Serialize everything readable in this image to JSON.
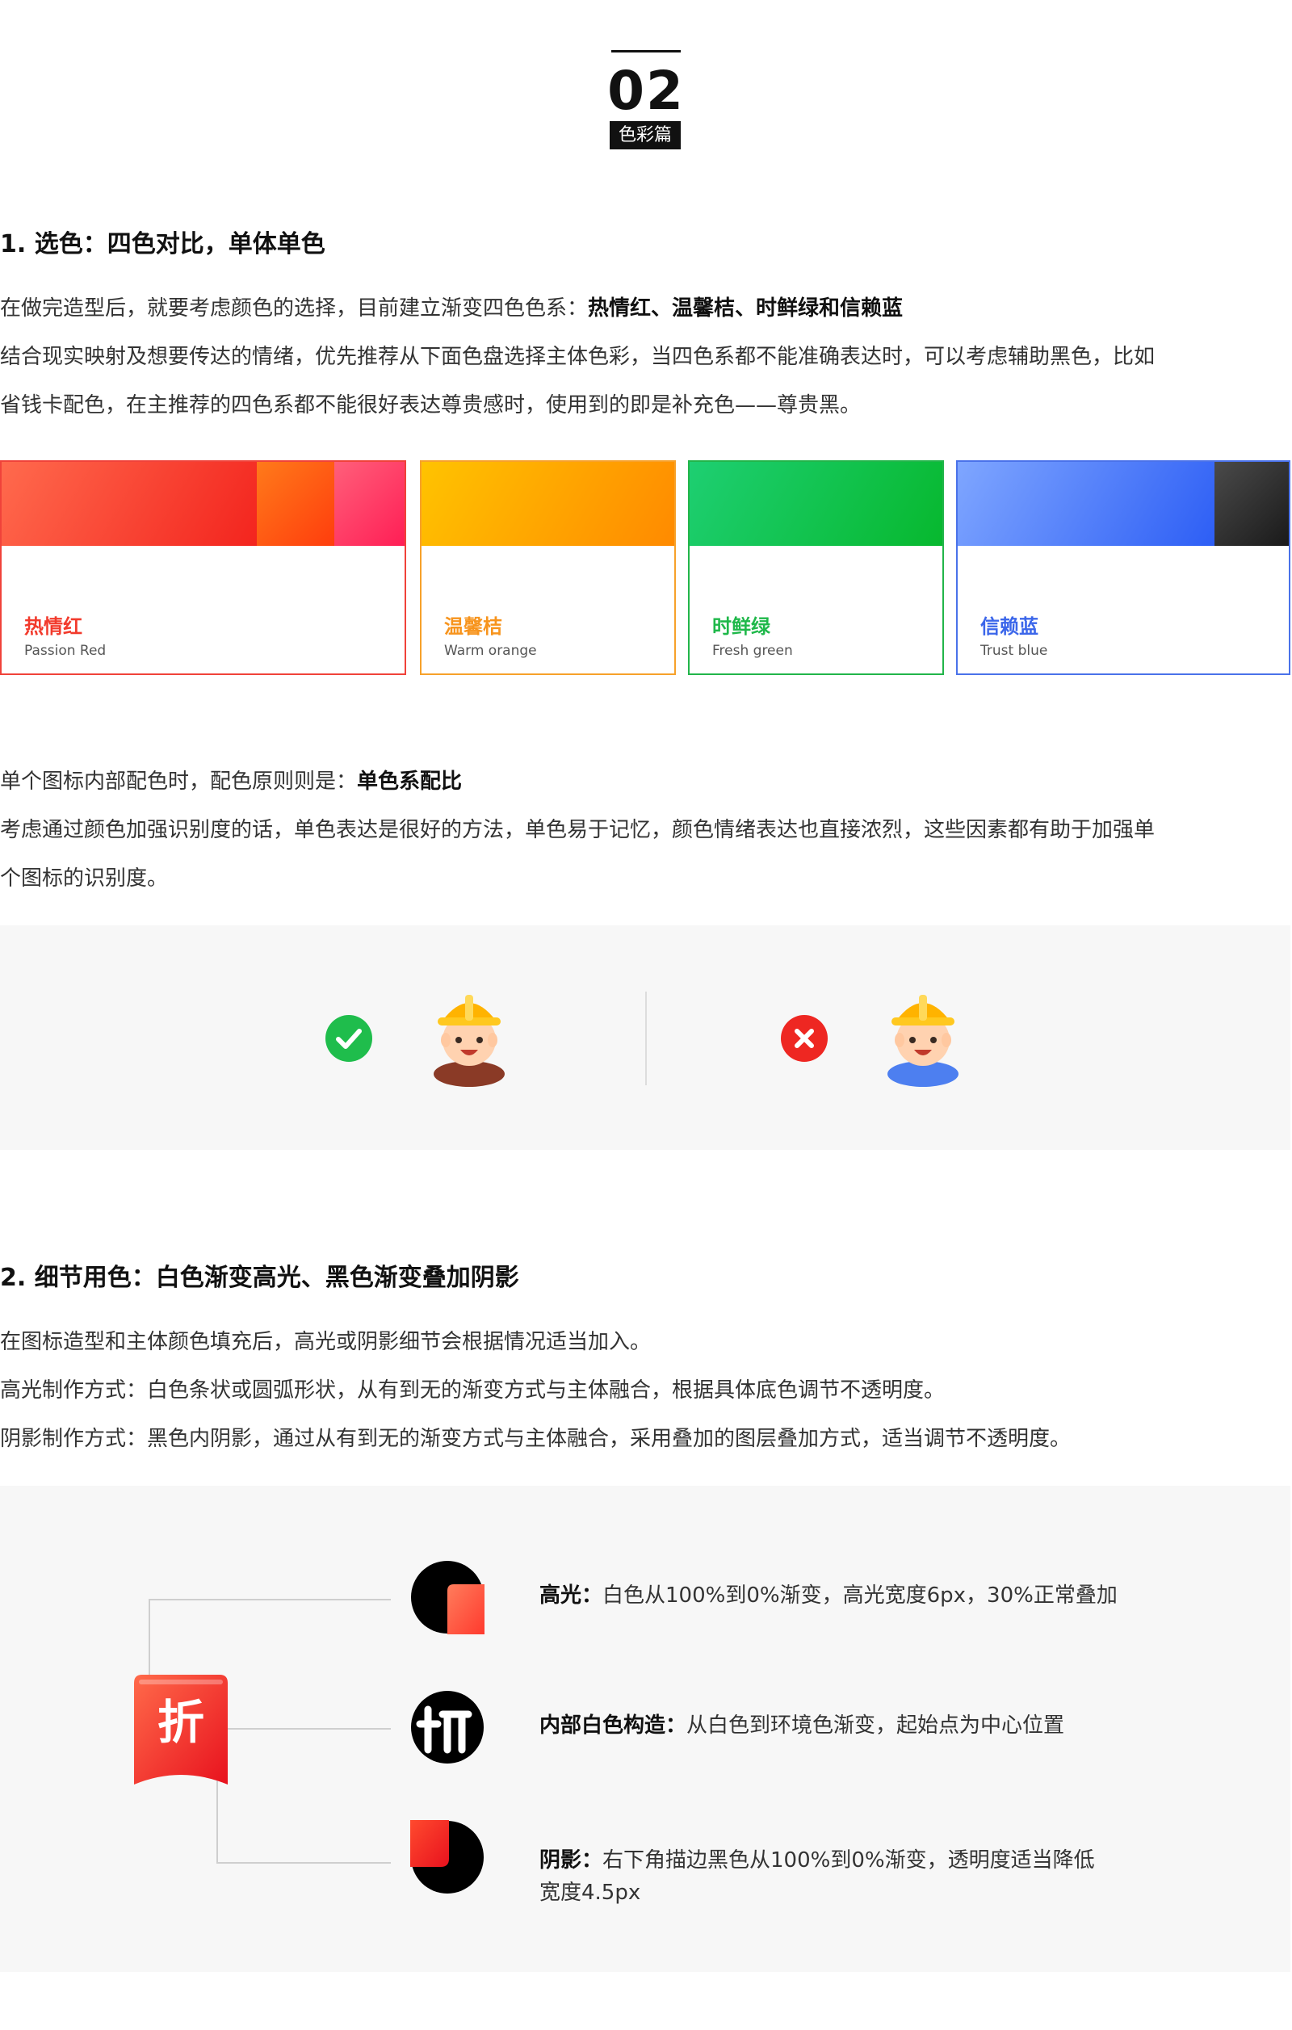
{
  "header": {
    "number": "02",
    "tag": "色彩篇"
  },
  "section1": {
    "title": "1. 选色：四色对比，单体单色",
    "intro_prefix": "在做完造型后，就要考虑颜色的选择，目前建立渐变四色色系：",
    "intro_bold": "热情红、温馨桔、时鲜绿和信赖蓝",
    "line2": "结合现实映射及想要传达的情绪，优先推荐从下面色盘选择主体色彩，当四色系都不能准确表达时，可以考虑辅助黑色，比如",
    "line3": "省钱卡配色，在主推荐的四色系都不能很好表达尊贵感时，使用到的即是补充色——尊贵黑。",
    "cards": [
      {
        "cn": "热情红",
        "en": "Passion Red",
        "color": "#f23a2c"
      },
      {
        "cn": "温馨桔",
        "en": "Warm orange",
        "color": "#f7941d"
      },
      {
        "cn": "时鲜绿",
        "en": "Fresh green",
        "color": "#1fb84a"
      },
      {
        "cn": "信赖蓝",
        "en": "Trust blue",
        "color": "#3b66ea"
      }
    ],
    "mono_prefix": "单个图标内部配色时，配色原则则是：",
    "mono_bold": "单色系配比",
    "mono_line2": "考虑通过颜色加强识别度的话，单色表达是很好的方法，单色易于记忆，颜色情绪表达也直接浓烈，这些因素都有助于加强单",
    "mono_line3": "个图标的识别度。"
  },
  "section2": {
    "title": "2. 细节用色：白色渐变高光、黑色渐变叠加阴影",
    "line1": "在图标造型和主体颜色填充后，高光或阴影细节会根据情况适当加入。",
    "line2": "高光制作方式：白色条状或圆弧形状，从有到无的渐变方式与主体融合，根据具体底色调节不透明度。",
    "line3": "阴影制作方式：黑色内阴影，通过从有到无的渐变方式与主体融合，采用叠加的图层叠加方式，适当调节不透明度。",
    "details": [
      {
        "label": "高光：",
        "text": "白色从100%到0%渐变，高光宽度6px，30%正常叠加"
      },
      {
        "label": "内部白色构造：",
        "text": "从白色到环境色渐变，起始点为中心位置"
      },
      {
        "label": "阴影：",
        "text": "右下角描边黑色从100%到0%渐变，透明度适当降低",
        "text2": "宽度4.5px"
      }
    ],
    "icon_char": "折"
  }
}
